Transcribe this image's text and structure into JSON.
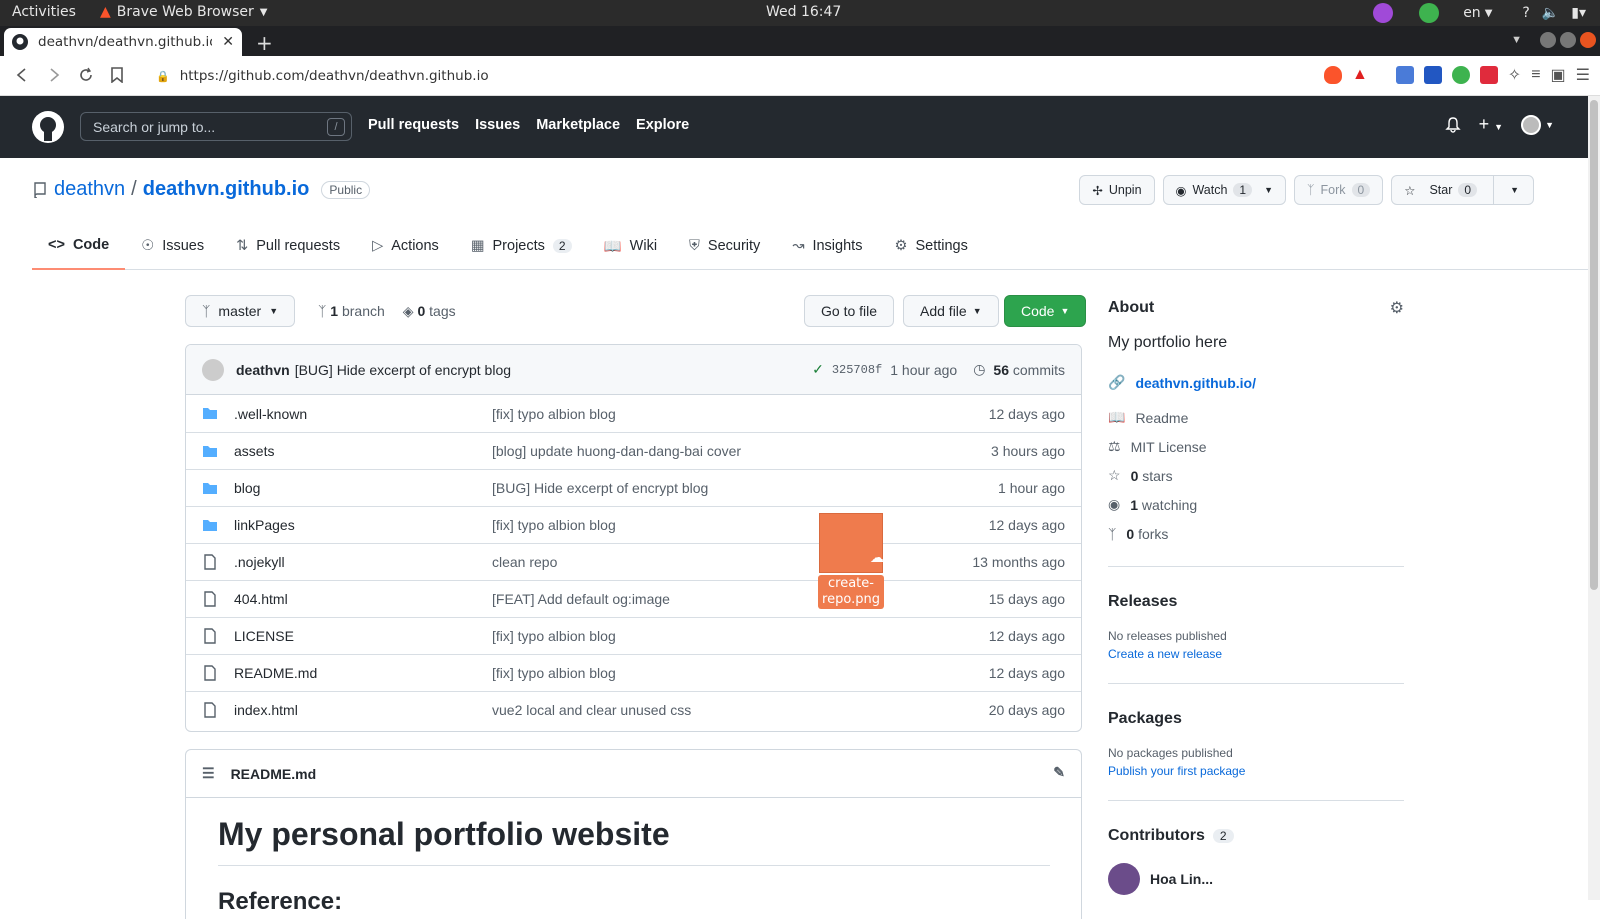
{
  "os": {
    "activities": "Activities",
    "app_name": "Brave Web Browser",
    "clock": "Wed 16:47",
    "lang": "en"
  },
  "browser": {
    "tab_title": "deathvn/deathvn.github.io",
    "url": "https://github.com/deathvn/deathvn.github.io"
  },
  "gh_header": {
    "search_placeholder": "Search or jump to...",
    "search_hint": "/",
    "nav": [
      "Pull requests",
      "Issues",
      "Marketplace",
      "Explore"
    ]
  },
  "repo": {
    "owner": "deathvn",
    "separator": "/",
    "name": "deathvn.github.io",
    "visibility": "Public",
    "unpin": "Unpin",
    "watch": "Watch",
    "watch_count": "1",
    "fork": "Fork",
    "fork_count": "0",
    "star": "Star",
    "star_count": "0"
  },
  "tabs": [
    {
      "label": "Code",
      "icon": "code-icon"
    },
    {
      "label": "Issues",
      "icon": "issue-icon"
    },
    {
      "label": "Pull requests",
      "icon": "pull-request-icon"
    },
    {
      "label": "Actions",
      "icon": "play-icon"
    },
    {
      "label": "Projects",
      "icon": "table-icon",
      "count": "2"
    },
    {
      "label": "Wiki",
      "icon": "book-icon"
    },
    {
      "label": "Security",
      "icon": "shield-icon"
    },
    {
      "label": "Insights",
      "icon": "graph-icon"
    },
    {
      "label": "Settings",
      "icon": "gear-icon"
    }
  ],
  "toolbar": {
    "branch": "master",
    "branch_count": "1",
    "branch_label": "branch",
    "tag_count": "0",
    "tag_label": "tags",
    "go_to_file": "Go to file",
    "add_file": "Add file",
    "code": "Code"
  },
  "commit": {
    "author": "deathvn",
    "message": "[BUG] Hide excerpt of encrypt blog",
    "sha": "325708f",
    "time": "1 hour ago",
    "count": "56",
    "count_label": "commits"
  },
  "files": [
    {
      "name": ".well-known",
      "type": "dir",
      "message": "[fix] typo albion blog",
      "age": "12 days ago"
    },
    {
      "name": "assets",
      "type": "dir",
      "message": "[blog] update huong-dan-dang-bai cover",
      "age": "3 hours ago"
    },
    {
      "name": "blog",
      "type": "dir",
      "message": "[BUG] Hide excerpt of encrypt blog",
      "age": "1 hour ago"
    },
    {
      "name": "linkPages",
      "type": "dir",
      "message": "[fix] typo albion blog",
      "age": "12 days ago"
    },
    {
      "name": ".nojekyll",
      "type": "file",
      "message": "clean repo",
      "age": "13 months ago"
    },
    {
      "name": "404.html",
      "type": "file",
      "message": "[FEAT] Add default og:image",
      "age": "15 days ago"
    },
    {
      "name": "LICENSE",
      "type": "file",
      "message": "[fix] typo albion blog",
      "age": "12 days ago"
    },
    {
      "name": "README.md",
      "type": "file",
      "message": "[fix] typo albion blog",
      "age": "12 days ago"
    },
    {
      "name": "index.html",
      "type": "file",
      "message": "vue2 local and clear unused css",
      "age": "20 days ago"
    }
  ],
  "drag": {
    "label1": "create-",
    "label2": "repo.png"
  },
  "readme": {
    "filename": "README.md",
    "h1": "My personal portfolio website",
    "h2": "Reference:"
  },
  "about": {
    "title": "About",
    "description": "My portfolio here",
    "website": "deathvn.github.io/",
    "readme": "Readme",
    "license": "MIT License",
    "stars_count": "0",
    "stars_label": "stars",
    "watching_count": "1",
    "watching_label": "watching",
    "forks_count": "0",
    "forks_label": "forks"
  },
  "releases": {
    "title": "Releases",
    "none": "No releases published",
    "link": "Create a new release"
  },
  "packages": {
    "title": "Packages",
    "none": "No packages published",
    "link": "Publish your first package"
  },
  "contributors": {
    "title": "Contributors",
    "count": "2",
    "first": "Hoa Lin..."
  }
}
